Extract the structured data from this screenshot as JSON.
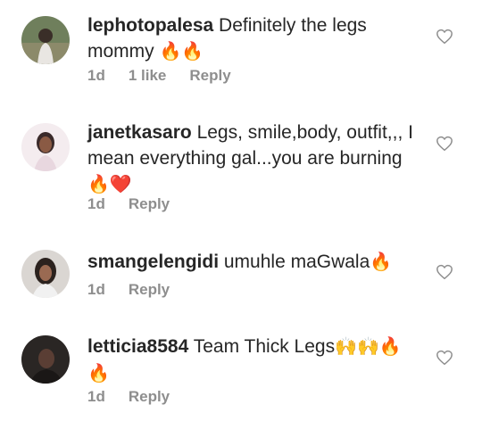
{
  "comments": [
    {
      "username": "lephotopalesa",
      "text": "Definitely the legs mommy",
      "emoji": "🔥🔥",
      "time": "1d",
      "likes": "1 like",
      "reply": "Reply",
      "avatar_color": "#7a8a6a"
    },
    {
      "username": "janetkasaro",
      "text": "Legs, smile,body, outfit,,, I mean everything gal...you are burning",
      "emoji": "🔥❤️",
      "time": "1d",
      "likes": "",
      "reply": "Reply",
      "avatar_color": "#f3e6ea"
    },
    {
      "username": "smangelengidi",
      "text": "umuhle maGwala",
      "emoji": "🔥",
      "time": "1d",
      "likes": "",
      "reply": "Reply",
      "avatar_color": "#d8d4d0"
    },
    {
      "username": "letticia8584",
      "text": "Team Thick Legs",
      "emoji": "🙌🙌🔥🔥",
      "time": "1d",
      "likes": "",
      "reply": "Reply",
      "avatar_color": "#2a2624"
    }
  ],
  "icons": {
    "like": "heart-outline-icon"
  }
}
